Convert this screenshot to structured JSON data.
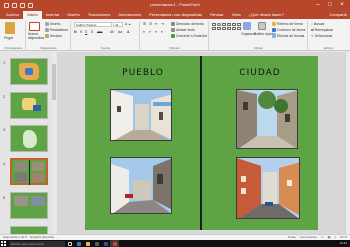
{
  "window": {
    "title": "presentacion1 - PowerPoint",
    "controls": [
      "minimize-icon",
      "maximize-icon",
      "close-icon"
    ]
  },
  "ribbon": {
    "tabs": [
      "Archivo",
      "Inicio",
      "Insertar",
      "Diseño",
      "Transiciones",
      "Animaciones",
      "Presentación con diapositivas",
      "Revisar",
      "Vista",
      "¿Qué desea hacer?"
    ],
    "active_tab": "Inicio",
    "share_label": "Compartir",
    "groups": {
      "clipboard": {
        "label": "Portapapeles",
        "paste": "Pegar"
      },
      "slides": {
        "label": "Diapositivas",
        "new_slide": "Nueva diapositiva",
        "layout": "Diseño",
        "reset": "Restablecer",
        "section": "Sección"
      },
      "font": {
        "label": "Fuente",
        "font_name": "Calibri (Títulos)",
        "font_size": "44"
      },
      "paragraph": {
        "label": "Párrafo",
        "direction": "Dirección del texto",
        "align": "Alinear texto",
        "smartart": "Convertir a SmartArt"
      },
      "drawing": {
        "label": "Dibujo",
        "arrange": "Organizar",
        "quick_styles": "Estilos rápidos"
      },
      "shape_props": {
        "fill": "Relleno de forma",
        "outline": "Contorno de forma",
        "effects": "Efectos de formas"
      },
      "editing": {
        "label": "Edición",
        "find": "Buscar",
        "replace": "Reemplazar",
        "select": "Seleccionar"
      }
    }
  },
  "thumbnails": {
    "numbers": [
      "1",
      "2",
      "3",
      "4",
      "5"
    ],
    "selected_index": 3
  },
  "slide": {
    "left_heading": "PUEBLO",
    "right_heading": "CIUDAD",
    "background": "#5ea444"
  },
  "status": {
    "slide_info": "Diapositiva 4 de 8",
    "language": "Español (España)",
    "notes": "Notas",
    "comments": "Comentarios",
    "zoom": "64 %"
  },
  "taskbar": {
    "search_placeholder": "Escribe aquí para buscar",
    "time": "12:44"
  },
  "colors": {
    "accent": "#b7472a",
    "slide_green": "#5ea444",
    "selected_thumb_border": "#c2612f"
  }
}
